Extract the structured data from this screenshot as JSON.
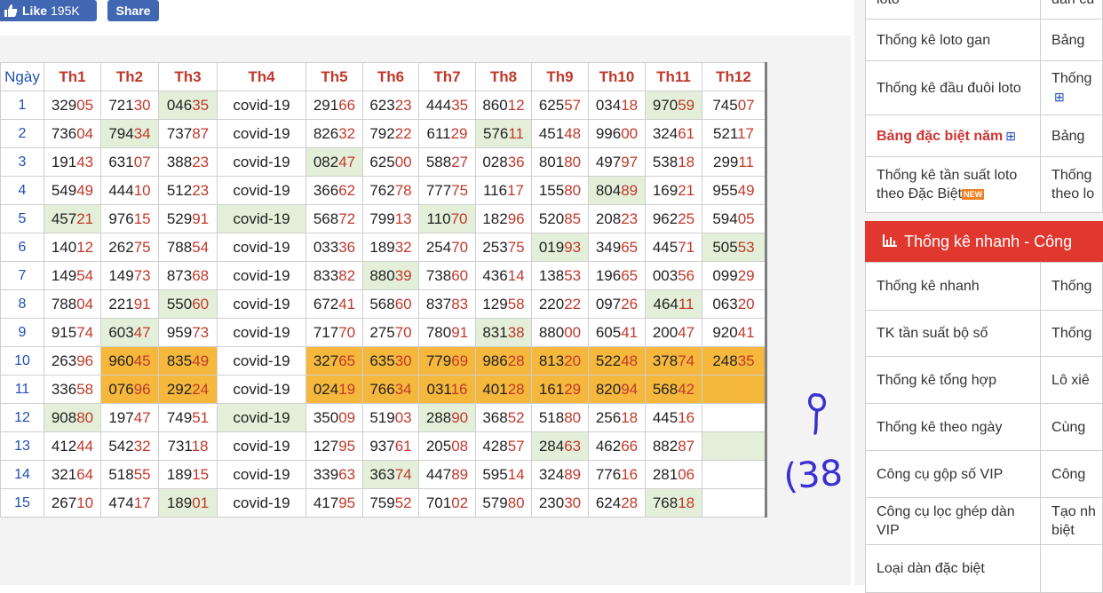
{
  "facebook": {
    "like_label": "Like",
    "like_count": "195K",
    "share_label": "Share"
  },
  "table": {
    "day_header": "Ngày",
    "months": [
      "Th1",
      "Th2",
      "Th3",
      "Th4",
      "Th5",
      "Th6",
      "Th7",
      "Th8",
      "Th9",
      "Th10",
      "Th11",
      "Th12"
    ],
    "rows": [
      {
        "day": "1",
        "cells": [
          {
            "v": "32905"
          },
          {
            "v": "72130"
          },
          {
            "v": "04635",
            "h": "g"
          },
          {
            "v": "covid-19"
          },
          {
            "v": "29166"
          },
          {
            "v": "62323"
          },
          {
            "v": "44435"
          },
          {
            "v": "86012"
          },
          {
            "v": "62557"
          },
          {
            "v": "03418"
          },
          {
            "v": "97059",
            "h": "g"
          },
          {
            "v": "74507"
          }
        ]
      },
      {
        "day": "2",
        "cells": [
          {
            "v": "73604"
          },
          {
            "v": "79434",
            "h": "g"
          },
          {
            "v": "73787"
          },
          {
            "v": "covid-19"
          },
          {
            "v": "82632"
          },
          {
            "v": "79222"
          },
          {
            "v": "61129"
          },
          {
            "v": "57611",
            "h": "g"
          },
          {
            "v": "45148"
          },
          {
            "v": "99600"
          },
          {
            "v": "32461"
          },
          {
            "v": "52117"
          }
        ]
      },
      {
        "day": "3",
        "cells": [
          {
            "v": "19143"
          },
          {
            "v": "63107"
          },
          {
            "v": "38823"
          },
          {
            "v": "covid-19"
          },
          {
            "v": "08247",
            "h": "g"
          },
          {
            "v": "62500"
          },
          {
            "v": "58827"
          },
          {
            "v": "02836"
          },
          {
            "v": "80180"
          },
          {
            "v": "49797"
          },
          {
            "v": "53818"
          },
          {
            "v": "29911"
          }
        ]
      },
      {
        "day": "4",
        "cells": [
          {
            "v": "54949"
          },
          {
            "v": "44410"
          },
          {
            "v": "51223"
          },
          {
            "v": "covid-19"
          },
          {
            "v": "36662"
          },
          {
            "v": "76278"
          },
          {
            "v": "77775"
          },
          {
            "v": "11617"
          },
          {
            "v": "15580"
          },
          {
            "v": "80489",
            "h": "g"
          },
          {
            "v": "16921"
          },
          {
            "v": "95549"
          }
        ]
      },
      {
        "day": "5",
        "cells": [
          {
            "v": "45721",
            "h": "g"
          },
          {
            "v": "97615"
          },
          {
            "v": "52991"
          },
          {
            "v": "covid-19",
            "h": "g"
          },
          {
            "v": "56872"
          },
          {
            "v": "79913"
          },
          {
            "v": "11070",
            "h": "g"
          },
          {
            "v": "18296"
          },
          {
            "v": "52085"
          },
          {
            "v": "20823"
          },
          {
            "v": "96225"
          },
          {
            "v": "59405"
          }
        ]
      },
      {
        "day": "6",
        "cells": [
          {
            "v": "14012"
          },
          {
            "v": "26275"
          },
          {
            "v": "78854"
          },
          {
            "v": "covid-19"
          },
          {
            "v": "03336"
          },
          {
            "v": "18932"
          },
          {
            "v": "25470"
          },
          {
            "v": "25375"
          },
          {
            "v": "01993",
            "h": "g"
          },
          {
            "v": "34965"
          },
          {
            "v": "44571"
          },
          {
            "v": "50553",
            "h": "g"
          }
        ]
      },
      {
        "day": "7",
        "cells": [
          {
            "v": "14954"
          },
          {
            "v": "14973"
          },
          {
            "v": "87368"
          },
          {
            "v": "covid-19"
          },
          {
            "v": "83382"
          },
          {
            "v": "88039",
            "h": "g"
          },
          {
            "v": "73860"
          },
          {
            "v": "43614"
          },
          {
            "v": "13853"
          },
          {
            "v": "19665"
          },
          {
            "v": "00356"
          },
          {
            "v": "09929"
          }
        ]
      },
      {
        "day": "8",
        "cells": [
          {
            "v": "78804"
          },
          {
            "v": "22191"
          },
          {
            "v": "55060",
            "h": "g"
          },
          {
            "v": "covid-19"
          },
          {
            "v": "67241"
          },
          {
            "v": "56860"
          },
          {
            "v": "83783"
          },
          {
            "v": "12958"
          },
          {
            "v": "22022"
          },
          {
            "v": "09726"
          },
          {
            "v": "46411",
            "h": "g"
          },
          {
            "v": "06320"
          }
        ]
      },
      {
        "day": "9",
        "cells": [
          {
            "v": "91574"
          },
          {
            "v": "60347",
            "h": "g"
          },
          {
            "v": "95973"
          },
          {
            "v": "covid-19"
          },
          {
            "v": "71770"
          },
          {
            "v": "27570"
          },
          {
            "v": "78091"
          },
          {
            "v": "83138",
            "h": "g"
          },
          {
            "v": "88000"
          },
          {
            "v": "60541"
          },
          {
            "v": "20047"
          },
          {
            "v": "92041"
          }
        ]
      },
      {
        "day": "10",
        "cells": [
          {
            "v": "26396"
          },
          {
            "v": "96045",
            "h": "y"
          },
          {
            "v": "83549",
            "h": "y"
          },
          {
            "v": "covid-19"
          },
          {
            "v": "32765",
            "h": "y"
          },
          {
            "v": "63530",
            "h": "y"
          },
          {
            "v": "77969",
            "h": "y"
          },
          {
            "v": "98628",
            "h": "y"
          },
          {
            "v": "81320",
            "h": "y"
          },
          {
            "v": "52248",
            "h": "y"
          },
          {
            "v": "37874",
            "h": "y"
          },
          {
            "v": "24835",
            "h": "y"
          }
        ]
      },
      {
        "day": "11",
        "cells": [
          {
            "v": "33658"
          },
          {
            "v": "07696",
            "h": "y"
          },
          {
            "v": "29224",
            "h": "y"
          },
          {
            "v": "covid-19"
          },
          {
            "v": "02419",
            "h": "y"
          },
          {
            "v": "76634",
            "h": "y"
          },
          {
            "v": "03116",
            "h": "y"
          },
          {
            "v": "40128",
            "h": "y"
          },
          {
            "v": "16129",
            "h": "y"
          },
          {
            "v": "82094",
            "h": "y"
          },
          {
            "v": "56842",
            "h": "y"
          },
          {
            "v": "",
            "h": "y"
          }
        ]
      },
      {
        "day": "12",
        "cells": [
          {
            "v": "90880",
            "h": "g"
          },
          {
            "v": "19747"
          },
          {
            "v": "74951"
          },
          {
            "v": "covid-19",
            "h": "g"
          },
          {
            "v": "35009"
          },
          {
            "v": "51903"
          },
          {
            "v": "28890",
            "h": "g"
          },
          {
            "v": "36852"
          },
          {
            "v": "51880"
          },
          {
            "v": "25618"
          },
          {
            "v": "44516"
          },
          {
            "v": ""
          }
        ]
      },
      {
        "day": "13",
        "cells": [
          {
            "v": "41244"
          },
          {
            "v": "54232"
          },
          {
            "v": "73118"
          },
          {
            "v": "covid-19"
          },
          {
            "v": "12795"
          },
          {
            "v": "93761"
          },
          {
            "v": "20508"
          },
          {
            "v": "42857"
          },
          {
            "v": "28463",
            "h": "g"
          },
          {
            "v": "46266"
          },
          {
            "v": "88287"
          },
          {
            "v": "",
            "h": "g"
          }
        ]
      },
      {
        "day": "14",
        "cells": [
          {
            "v": "32164"
          },
          {
            "v": "51855"
          },
          {
            "v": "18915"
          },
          {
            "v": "covid-19"
          },
          {
            "v": "33963"
          },
          {
            "v": "36374",
            "h": "g"
          },
          {
            "v": "44789"
          },
          {
            "v": "59514"
          },
          {
            "v": "32489"
          },
          {
            "v": "77616"
          },
          {
            "v": "28106"
          },
          {
            "v": ""
          }
        ]
      },
      {
        "day": "15",
        "cells": [
          {
            "v": "26710"
          },
          {
            "v": "47417"
          },
          {
            "v": "18901",
            "h": "g"
          },
          {
            "v": "covid-19"
          },
          {
            "v": "41795"
          },
          {
            "v": "75952"
          },
          {
            "v": "70102"
          },
          {
            "v": "57980"
          },
          {
            "v": "23030"
          },
          {
            "v": "62428"
          },
          {
            "v": "76818",
            "h": "g"
          },
          {
            "v": ""
          }
        ]
      }
    ]
  },
  "sidebar": {
    "top_rows": [
      {
        "c1": "loto",
        "c2": "dàn cù"
      },
      {
        "c1": "Thống kê loto gan",
        "c2": "Bảng"
      },
      {
        "c1": "Thống kê đầu đuôi loto",
        "c2": "Thống"
      },
      {
        "c1": "Bảng đặc biệt năm",
        "c2": "Bảng"
      },
      {
        "c1": "Thống kê tần suất loto theo Đặc Biệt",
        "c2": "Thống",
        "c2b": "theo lo"
      }
    ],
    "new_badge": "NEW",
    "quick_header": "Thống kê nhanh - Công",
    "quick_rows": [
      {
        "c1": "Thống kê nhanh",
        "c2": "Thống"
      },
      {
        "c1": "TK tần suất bộ số",
        "c2": "Thống"
      },
      {
        "c1": "Thống kê tổng hợp",
        "c2": "Lô xiê"
      },
      {
        "c1": "Thống kê theo ngày",
        "c2": "Cùng"
      },
      {
        "c1": "Công cụ gộp số VIP",
        "c2": "Công"
      },
      {
        "c1": "Công cụ lọc ghép dàn VIP",
        "c2": "Tạo nh",
        "c2b": "biệt"
      },
      {
        "c1": "Loại dàn đặc biệt",
        "c2": ""
      }
    ]
  },
  "handwriting": {
    "text": "(38"
  },
  "colors": {
    "accent_red": "#c0392b",
    "day_blue": "#1f4fb5",
    "highlight_green": "#e4efd9",
    "highlight_yellow": "#f5b83d",
    "ink": "#3a2fd0",
    "quick_header_bg": "#e0382f"
  }
}
